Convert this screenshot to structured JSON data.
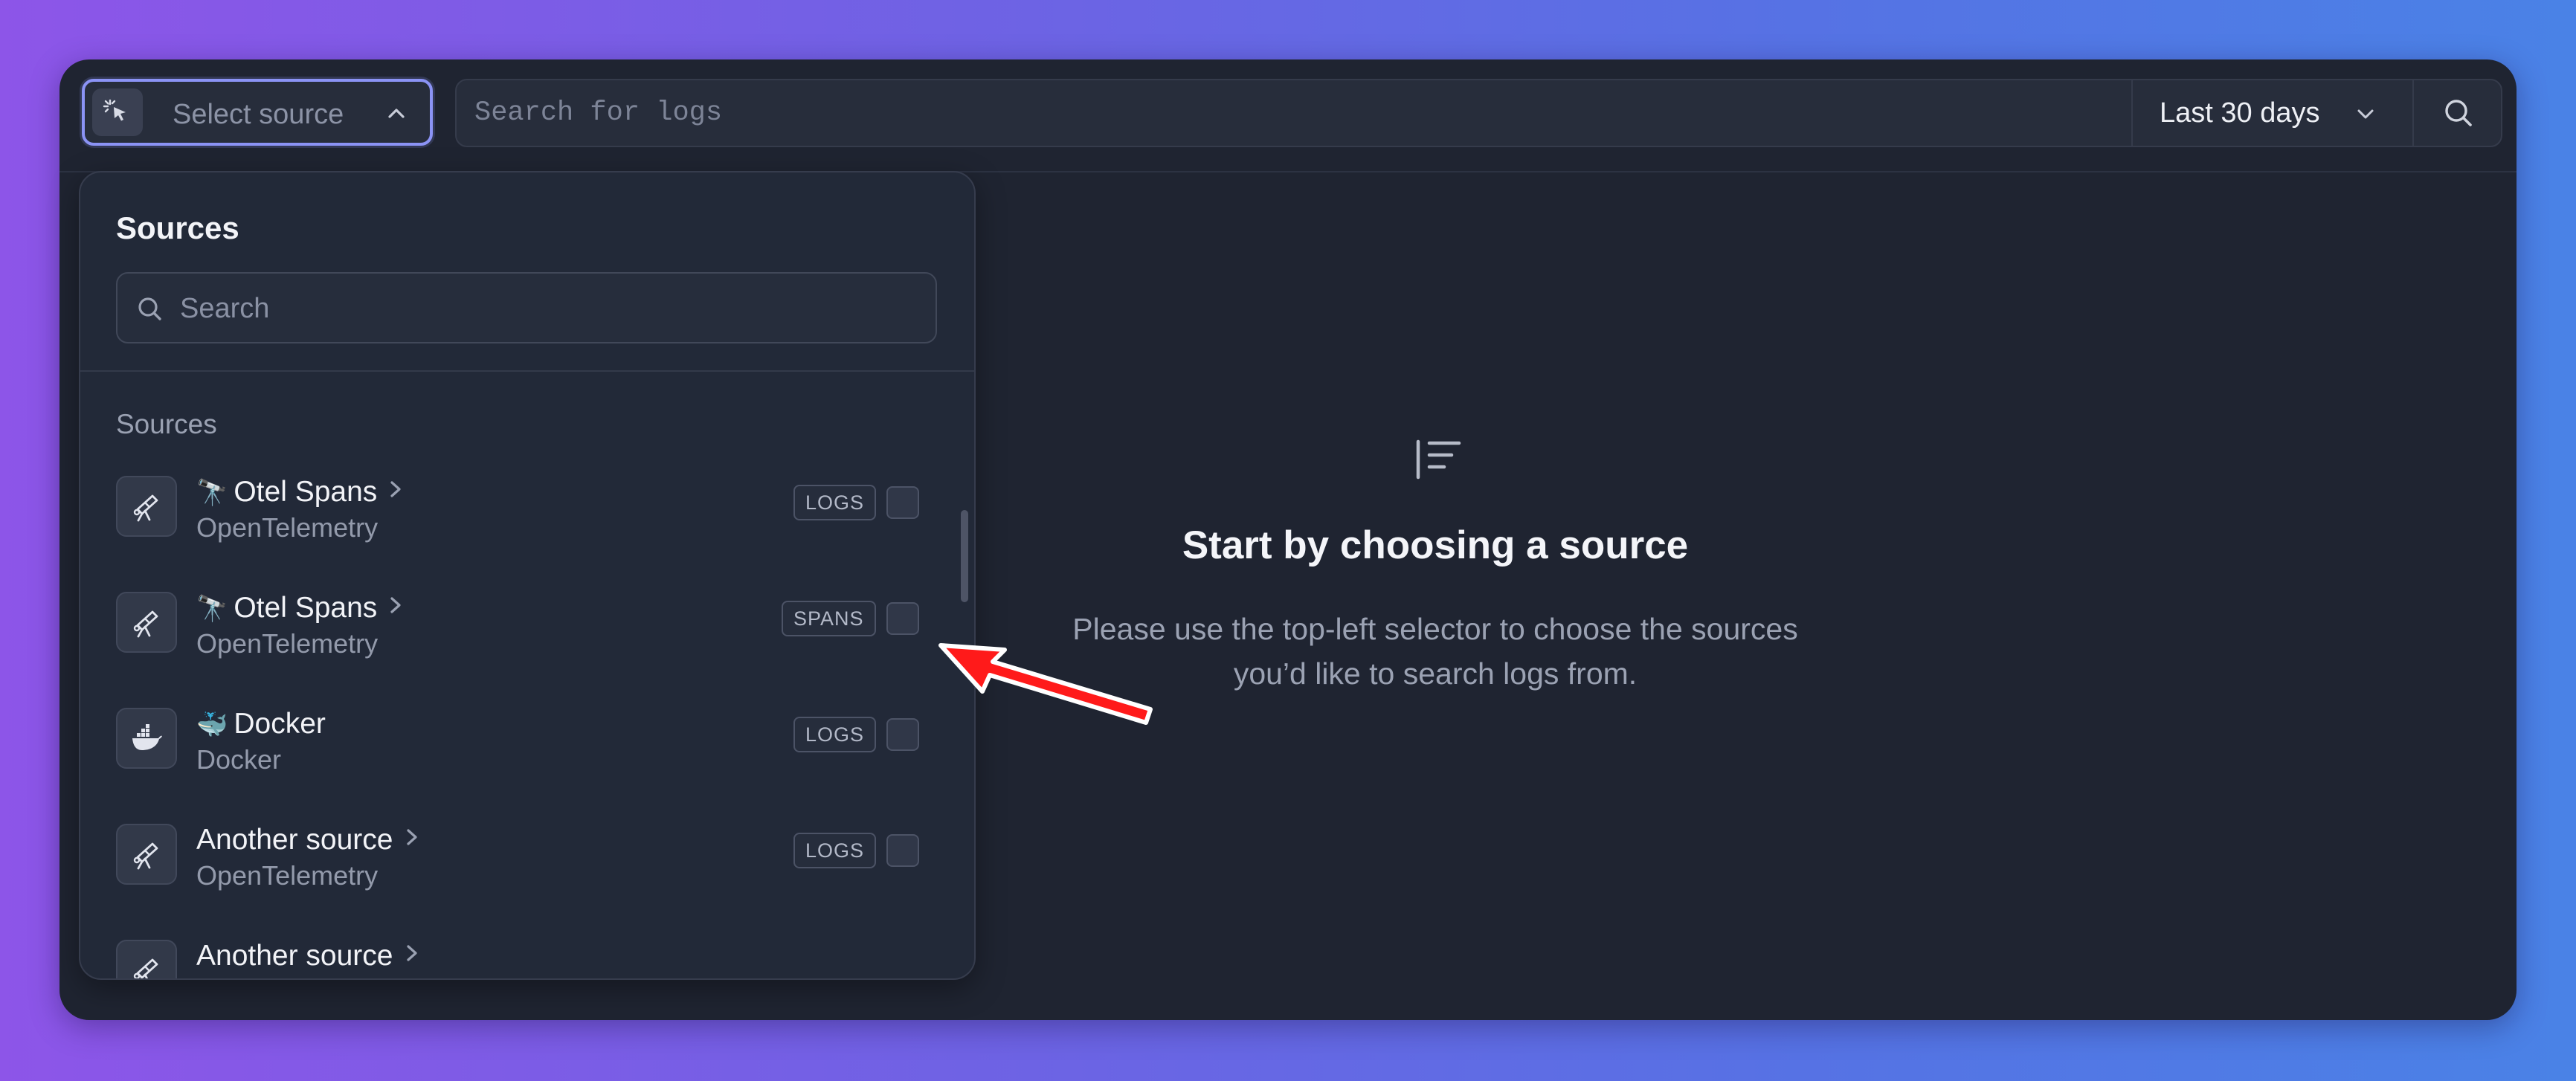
{
  "toolbar": {
    "source_select_label": "Select source",
    "query_placeholder": "Search for logs",
    "time_range_label": "Last 30 days"
  },
  "source_panel": {
    "title": "Sources",
    "search_placeholder": "Search",
    "section_label": "Sources",
    "items": [
      {
        "emoji": "🔭",
        "name": "Otel Spans",
        "subtitle": "OpenTelemetry",
        "badge": "LOGS",
        "icon": "telescope-icon",
        "has_chevron": true
      },
      {
        "emoji": "🔭",
        "name": "Otel Spans",
        "subtitle": "OpenTelemetry",
        "badge": "SPANS",
        "icon": "telescope-icon",
        "has_chevron": true
      },
      {
        "emoji": "🐳",
        "name": "Docker",
        "subtitle": "Docker",
        "badge": "LOGS",
        "icon": "docker-whale-icon",
        "has_chevron": false
      },
      {
        "emoji": "",
        "name": "Another source",
        "subtitle": "OpenTelemetry",
        "badge": "LOGS",
        "icon": "telescope-icon",
        "has_chevron": true
      },
      {
        "emoji": "",
        "name": "Another source",
        "subtitle": "",
        "badge": "",
        "icon": "telescope-icon",
        "has_chevron": true
      }
    ]
  },
  "empty_state": {
    "icon": "align-left-icon",
    "title": "Start by choosing a source",
    "description": "Please use the top-left selector to choose the sources you’d like to search logs from."
  },
  "colors": {
    "background_gradient_start": "#8d55e8",
    "background_gradient_end": "#4a82e6",
    "window": "#1f2431",
    "panel": "#222938",
    "focus_ring": "#8b93f5",
    "annotation_arrow": "#ff1a1a"
  }
}
